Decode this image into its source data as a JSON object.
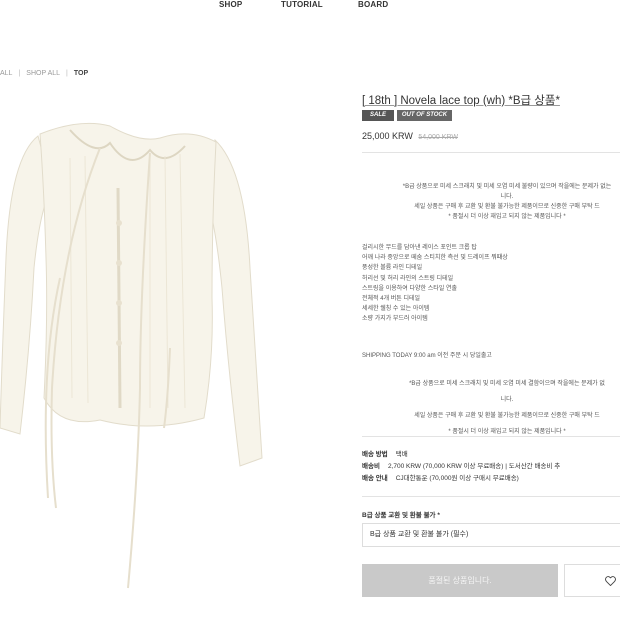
{
  "nav": {
    "items": [
      "SHOP",
      "TUTORIAL",
      "BOARD"
    ]
  },
  "breadcrumb": {
    "items": [
      "ALL",
      "SHOP ALL",
      "TOP"
    ]
  },
  "product": {
    "title": "[ 18th ] Novela lace top (wh) *B급 상품*",
    "badge_sale": "SALE",
    "badge_soldout": "OUT OF STOCK",
    "price": "25,000 KRW",
    "old_price": "54,000 KRW"
  },
  "description": {
    "notice_lines": [
      "*B급 상품으로 미세 스크래치 및 미세 오염 미세 불량이 있으며 작을에는 문제가 없는",
      "니다.",
      "세일 상품은 구매 후 교환 및 환불 불가능한 제품이므로 신중한 구매 부탁 드",
      "* 품절시 더 이상 재입고 되지 않는 제품입니다 *"
    ],
    "features": [
      "걸리시한 무드를 담아낸 레이스 포인트 크롭 탑",
      "어깨 나라 중앙으로 떼숨 스티치한 측선 및 드레이프 뭐떄상",
      "풍성한 볼륨 라인 디테일",
      "허리선 및 허리 라인의 스트링 디테일",
      "스트링을 이용하여 다양한 스타일 연출",
      "전체적 4개 버튼 디테일",
      "세세한 쉘칭 수 있는 아이템",
      "소량 가지가 부드러 아이템"
    ],
    "shipping": "SHIPPING TODAY 9:00 am 이전 주문 시 당일출고",
    "notice_lines_2": [
      "*B급 상품으로 미세 스크래치 및 미세 오염 미세 결함이으며 작을에는 문제가 없",
      "니다.",
      "세일 상품은 구매 후 교환 및 환불 불가능한 제품이므로 신중한 구매 부탁 드",
      "* 품절시 더 이상 재입고 되지 않는 제품입니다 *"
    ]
  },
  "delivery": {
    "method_label": "배송 방법",
    "method_value": "택배",
    "fee_label": "배송비",
    "fee_value": "2,700 KRW (70,000 KRW 이상 무료배송)  |  도서산간 배송비 추",
    "info_label": "배송 안내",
    "info_value": "CJ대한통운 (70,000원 이상 구매시 무료배송)"
  },
  "option": {
    "label": "B급 상품 교환 및 환불 불가 *",
    "selected": "B급 상품 교환 및 환불 불가 (필수)"
  },
  "actions": {
    "soldout_label": "품절된 상품입니다."
  },
  "icons": {
    "wishlist": "heart-icon"
  }
}
